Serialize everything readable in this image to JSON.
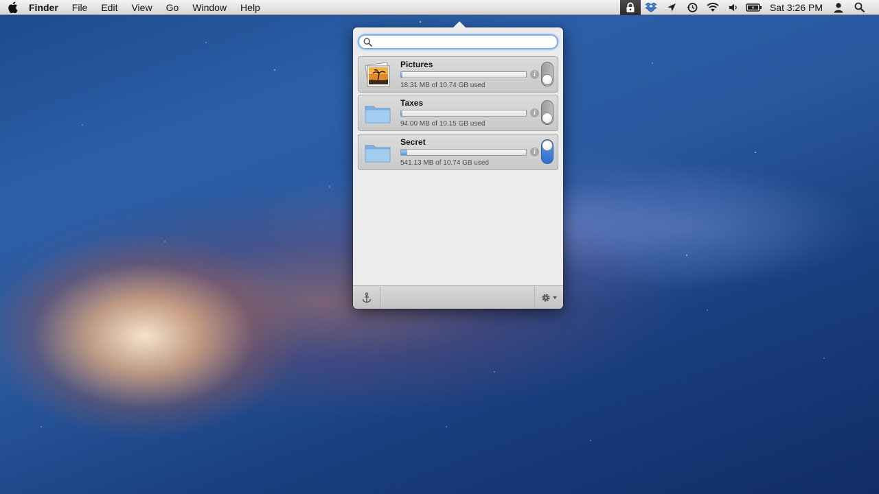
{
  "menubar": {
    "app_name": "Finder",
    "menus": [
      "File",
      "Edit",
      "View",
      "Go",
      "Window",
      "Help"
    ],
    "status_icons": [
      "lock-icon",
      "dropbox-icon",
      "location-icon",
      "time-machine-icon",
      "wifi-icon",
      "volume-icon",
      "battery-icon"
    ],
    "clock": "Sat 3:26 PM"
  },
  "popover": {
    "search": {
      "value": "",
      "placeholder": ""
    },
    "vaults": [
      {
        "name": "Pictures",
        "usage": "18.31 MB of 10.74 GB used",
        "fraction": 0.002,
        "mounted": false,
        "thumb": "photo-icon"
      },
      {
        "name": "Taxes",
        "usage": "94.00 MB of 10.15 GB used",
        "fraction": 0.009,
        "mounted": false,
        "thumb": "folder-icon"
      },
      {
        "name": "Secret",
        "usage": "541.13 MB of 10.74 GB used",
        "fraction": 0.05,
        "mounted": true,
        "thumb": "folder-icon"
      }
    ],
    "info_glyph": "i"
  },
  "colors": {
    "accent": "#4a8ad8",
    "folder": "#8fbfe8"
  }
}
